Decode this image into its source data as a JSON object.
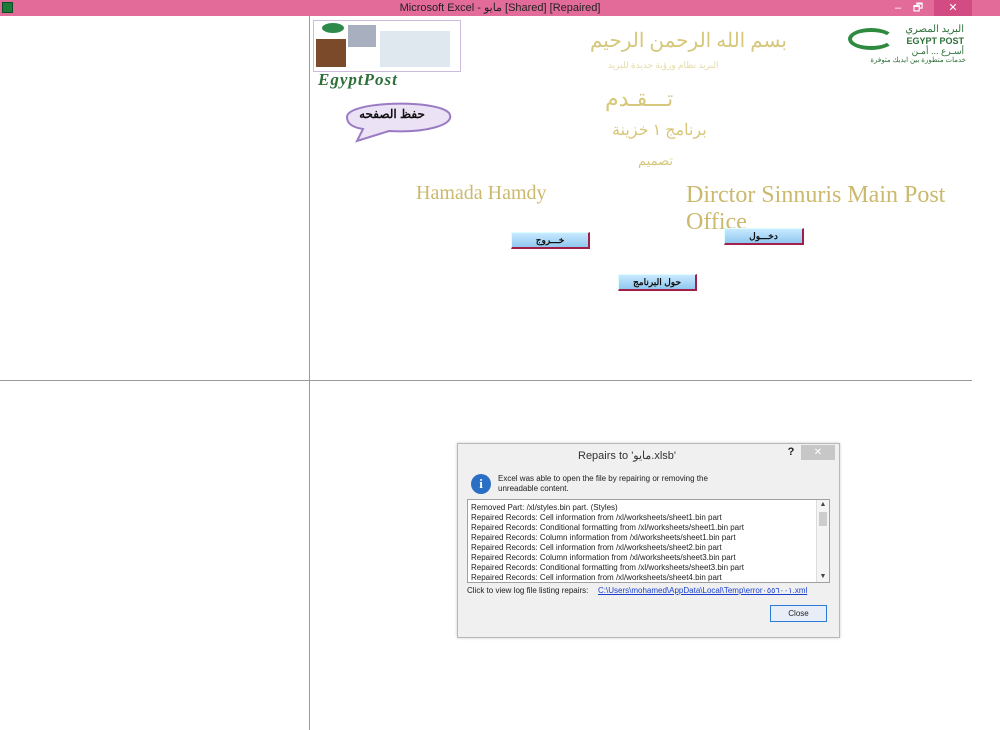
{
  "window": {
    "title": "Microsoft Excel - مايو  [Shared] [Repaired]",
    "minimize": "–",
    "maximize": "🗗",
    "close": "✕"
  },
  "sheet": {
    "logo_text": "EgyptPost",
    "save_page_label": "حفظ الصفحه",
    "basmala": "بسم الله الرحمن الرحيم",
    "motto": "البريد نظام ورؤية جديدة للبريد",
    "welcome": "تـــقـدم",
    "program": "برنامج ١ خزينة",
    "design": "تصميم",
    "author": "Hamada Hamdy",
    "director": "Dirctor Sinnuris Main Post Office",
    "post_logo": {
      "arabic": "البريد المصري",
      "english": "EGYPT POST",
      "arabic2": "أسـرع ... أمـن",
      "tagline": "خدمات متطورة بين ايديك متوفرة"
    },
    "buttons": {
      "exit": "خـــروج",
      "enter": "دخـــول",
      "about": "حول البرنامج"
    }
  },
  "dialog": {
    "title": "Repairs to 'مايو.xlsb'",
    "help": "?",
    "close_x": "✕",
    "message_line1": "Excel was able to open the file by repairing or removing the",
    "message_line2": "unreadable content.",
    "log_entries": [
      "Removed Part: /xl/styles.bin part.  (Styles)",
      "Repaired Records: Cell information from /xl/worksheets/sheet1.bin part",
      "Repaired Records: Conditional formatting from /xl/worksheets/sheet1.bin part",
      "Repaired Records: Column information from /xl/worksheets/sheet1.bin part",
      "Repaired Records: Cell information from /xl/worksheets/sheet2.bin part",
      "Repaired Records: Column information from /xl/worksheets/sheet3.bin part",
      "Repaired Records: Conditional formatting from /xl/worksheets/sheet3.bin part",
      "Repaired Records: Cell information from /xl/worksheets/sheet4.bin part"
    ],
    "log_label": "Click to view log file listing repairs:",
    "log_link": "C:\\Users\\mohamed\\AppData\\Local\\Temp\\error٠٥٥٦٠٠١.xml",
    "close_button": "Close",
    "info_icon": "i"
  },
  "colors": {
    "titlebar": "#e36b9a",
    "button_border": "#a0204a",
    "pale_text": "#d6c77a"
  }
}
